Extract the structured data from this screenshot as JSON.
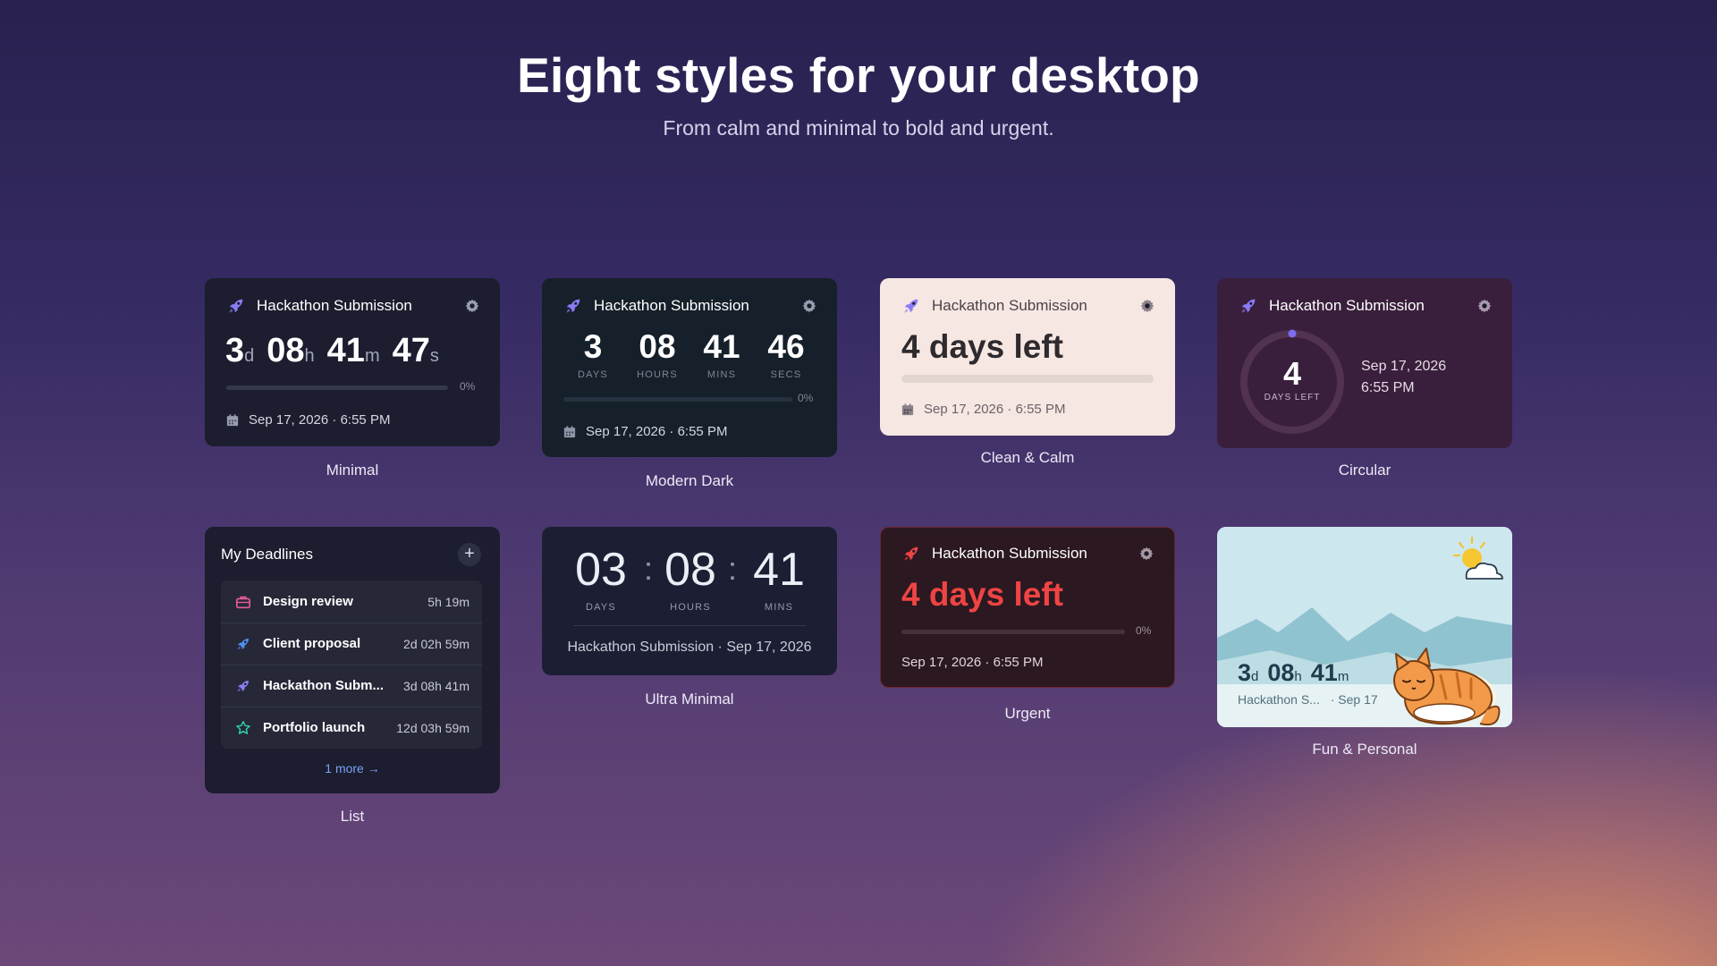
{
  "page": {
    "title": "Eight styles for your desktop",
    "subtitle": "From calm and minimal to bold and urgent."
  },
  "colors": {
    "accent_purple": "#8b7cf6",
    "urgent_red": "#ef4444",
    "clean_bg": "#f6e7e2",
    "circular_bg": "#3a1f3c",
    "modern_bg": "#16202a",
    "minimal_bg": "#1c1d2e"
  },
  "widgets": {
    "minimal": {
      "caption": "Minimal",
      "title": "Hackathon Submission",
      "d": "3",
      "d_unit": "d",
      "h": "08",
      "h_unit": "h",
      "m": "41",
      "m_unit": "m",
      "s": "47",
      "s_unit": "s",
      "progress_label": "0%",
      "progress": 0,
      "date": "Sep 17, 2026 · 6:55 PM"
    },
    "modern_dark": {
      "caption": "Modern Dark",
      "title": "Hackathon Submission",
      "days": "3",
      "days_label": "DAYS",
      "hours": "08",
      "hours_label": "HOURS",
      "mins": "41",
      "mins_label": "MINS",
      "secs": "46",
      "secs_label": "SECS",
      "progress_label": "0%",
      "progress": 0,
      "date": "Sep 17, 2026 · 6:55 PM"
    },
    "clean_calm": {
      "caption": "Clean & Calm",
      "title": "Hackathon Submission",
      "headline": "4 days left",
      "progress": 0,
      "date": "Sep 17, 2026 · 6:55 PM"
    },
    "circular": {
      "caption": "Circular",
      "title": "Hackathon Submission",
      "number": "4",
      "ring_label": "DAYS LEFT",
      "date_line1": "Sep 17, 2026",
      "date_line2": "6:55 PM",
      "progress": 0
    },
    "list": {
      "caption": "List",
      "title": "My Deadlines",
      "items": [
        {
          "name": "Design review",
          "value": "5h 19m",
          "icon": "briefcase-icon"
        },
        {
          "name": "Client proposal",
          "value": "2d 02h 59m",
          "icon": "rocket-icon"
        },
        {
          "name": "Hackathon Subm...",
          "value": "3d 08h 41m",
          "icon": "rocket-icon"
        },
        {
          "name": "Portfolio launch",
          "value": "12d 03h 59m",
          "icon": "star-icon"
        }
      ],
      "more": "1 more →"
    },
    "ultra_minimal": {
      "caption": "Ultra Minimal",
      "days": "03",
      "days_label": "DAYS",
      "hours": "08",
      "hours_label": "HOURS",
      "mins": "41",
      "mins_label": "MINS",
      "sep": ":",
      "footer": "Hackathon Submission · Sep 17, 2026"
    },
    "urgent": {
      "caption": "Urgent",
      "title": "Hackathon Submission",
      "headline": "4 days left",
      "progress_label": "0%",
      "progress": 0,
      "date": "Sep 17, 2026 · 6:55 PM"
    },
    "fun": {
      "caption": "Fun & Personal",
      "d": "3",
      "d_unit": "d",
      "h": "08",
      "h_unit": "h",
      "m": "41",
      "m_unit": "m",
      "name": "Hackathon S...",
      "date": "· Sep 17"
    }
  }
}
